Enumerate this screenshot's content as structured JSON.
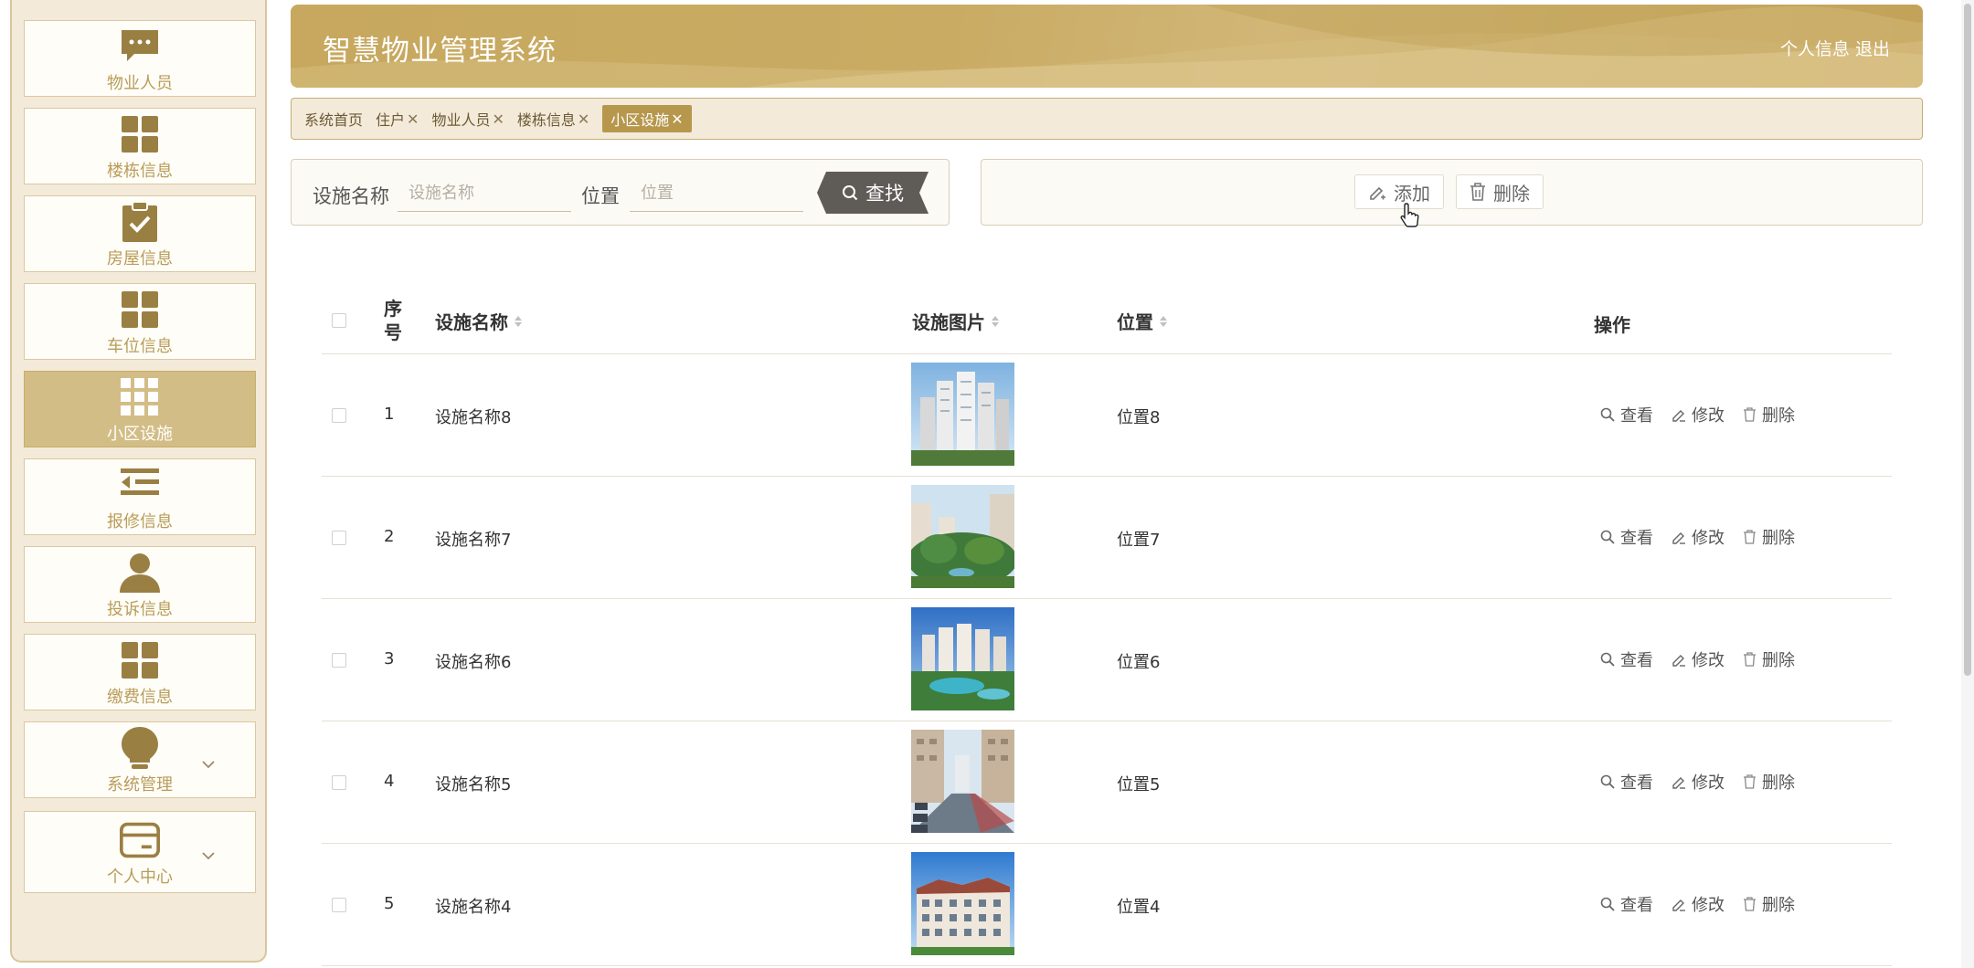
{
  "sidebar": {
    "items": [
      {
        "label": "物业人员",
        "icon": "chat-icon"
      },
      {
        "label": "楼栋信息",
        "icon": "grid-icon"
      },
      {
        "label": "房屋信息",
        "icon": "clipboard-check-icon"
      },
      {
        "label": "车位信息",
        "icon": "grid-icon"
      },
      {
        "label": "小区设施",
        "icon": "apps-grid-icon",
        "active": true
      },
      {
        "label": "报修信息",
        "icon": "list-indent-icon"
      },
      {
        "label": "投诉信息",
        "icon": "user-icon"
      },
      {
        "label": "缴费信息",
        "icon": "grid-icon"
      },
      {
        "label": "系统管理",
        "icon": "bulb-icon",
        "expandable": true
      },
      {
        "label": "个人中心",
        "icon": "card-icon",
        "expandable": true
      }
    ]
  },
  "header": {
    "title": "智慧物业管理系统",
    "profile_link": "个人信息",
    "logout_link": "退出"
  },
  "tabs": [
    {
      "label": "系统首页",
      "closable": false
    },
    {
      "label": "住户",
      "closable": true
    },
    {
      "label": "物业人员",
      "closable": true
    },
    {
      "label": "楼栋信息",
      "closable": true
    },
    {
      "label": "小区设施",
      "closable": true,
      "active": true
    }
  ],
  "tab_close_glyph": "✕",
  "search": {
    "name_label": "设施名称",
    "name_placeholder": "设施名称",
    "location_label": "位置",
    "location_placeholder": "位置",
    "button_label": "查找"
  },
  "actions": {
    "add_label": "添加",
    "delete_label": "删除"
  },
  "table": {
    "columns": {
      "index": "序号",
      "name": "设施名称",
      "image": "设施图片",
      "location": "位置",
      "ops": "操作"
    },
    "op_view": "查看",
    "op_edit": "修改",
    "op_delete": "删除",
    "rows": [
      {
        "index": "1",
        "name": "设施名称8",
        "location": "位置8",
        "image": "high-rise-towers"
      },
      {
        "index": "2",
        "name": "设施名称7",
        "location": "位置7",
        "image": "garden-courtyard"
      },
      {
        "index": "3",
        "name": "设施名称6",
        "location": "位置6",
        "image": "pool-complex"
      },
      {
        "index": "4",
        "name": "设施名称5",
        "location": "位置5",
        "image": "street-parking"
      },
      {
        "index": "5",
        "name": "设施名称4",
        "location": "位置4",
        "image": "apartment-block"
      }
    ]
  },
  "colors": {
    "accent": "#c7a85e",
    "sidebar_bg": "#f3ead9",
    "active_item": "#d3bd86",
    "icon_brown": "#9a7f43"
  }
}
